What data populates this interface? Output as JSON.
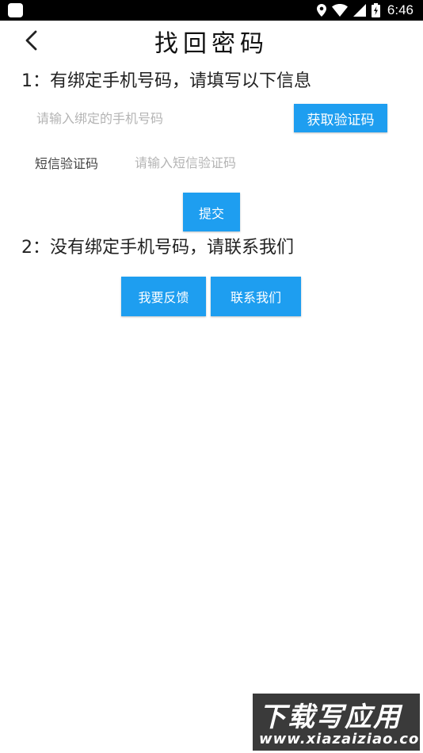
{
  "status_bar": {
    "time": "6:46",
    "icons": [
      "location-icon",
      "wifi-icon",
      "signal-icon",
      "battery-icon"
    ]
  },
  "header": {
    "title": "找回密码",
    "back_icon": "chevron-left-icon"
  },
  "section1": {
    "heading": "1：有绑定手机号码，请填写以下信息",
    "phone_placeholder": "请输入绑定的手机号码",
    "phone_value": "",
    "get_code_label": "获取验证码",
    "code_label": "短信验证码",
    "code_placeholder": "请输入短信验证码",
    "code_value": "",
    "submit_label": "提交"
  },
  "section2": {
    "heading": "2：没有绑定手机号码，请联系我们",
    "feedback_label": "我要反馈",
    "contact_label": "联系我们"
  },
  "watermark": {
    "logo_text": "下载写应用",
    "url_text": "www.xiazaiziao.com"
  },
  "colors": {
    "accent": "#1e9ef0",
    "status_bar": "#000000",
    "background": "#ffffff",
    "placeholder": "#b4b4b4"
  }
}
